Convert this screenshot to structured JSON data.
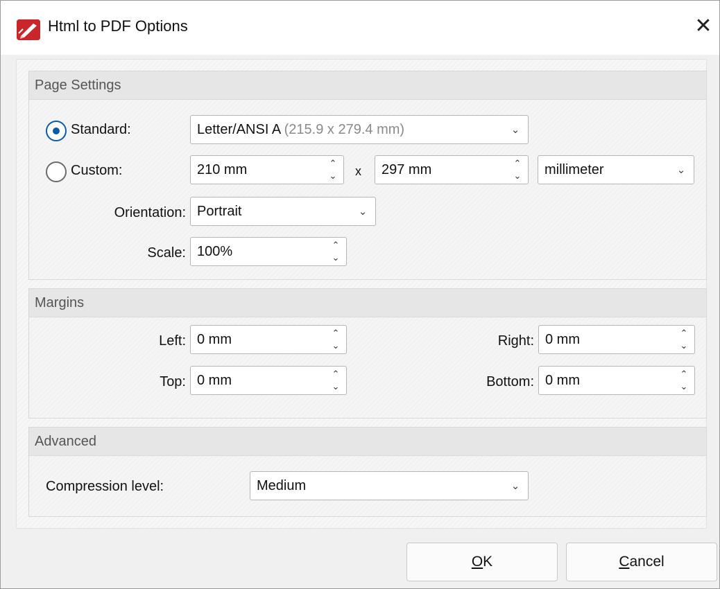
{
  "window": {
    "title": "Html to PDF Options",
    "close_glyph": "✕"
  },
  "page_settings": {
    "header": "Page Settings",
    "standard_label": "Standard:",
    "standard_selected": true,
    "standard_value": "Letter/ANSI A",
    "standard_value_detail": "(215.9 x 279.4 mm)",
    "custom_label": "Custom:",
    "custom_selected": false,
    "custom_width": "210 mm",
    "times": "x",
    "custom_height": "297 mm",
    "unit": "millimeter",
    "orientation_label": "Orientation:",
    "orientation": "Portrait",
    "scale_label": "Scale:",
    "scale": "100%"
  },
  "margins": {
    "header": "Margins",
    "left_label": "Left:",
    "left": "0 mm",
    "right_label": "Right:",
    "right": "0 mm",
    "top_label": "Top:",
    "top": "0 mm",
    "bottom_label": "Bottom:",
    "bottom": "0 mm"
  },
  "advanced": {
    "header": "Advanced",
    "compression_label": "Compression level:",
    "compression": "Medium"
  },
  "buttons": {
    "ok_mnemonic": "O",
    "ok_rest": "K",
    "cancel_mnemonic": "C",
    "cancel_rest": "ancel"
  },
  "icons": {
    "app": "pdf-editor-app-icon",
    "dropdown": "chevron-down-icon",
    "spin_up": "chevron-up-icon",
    "spin_down": "chevron-down-icon"
  },
  "colors": {
    "accent": "#0a5aa8",
    "app_icon": "#c8262b"
  }
}
